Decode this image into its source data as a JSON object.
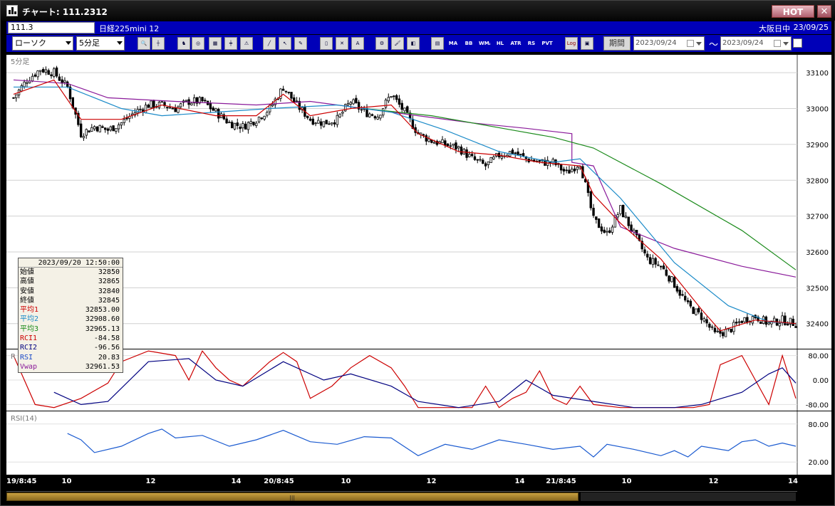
{
  "window": {
    "title": "チャート: 111.2312",
    "hot": "HOT",
    "close": "✕"
  },
  "info": {
    "symbol_code": "111.3",
    "symbol_name": "日経225mini 12",
    "session": "大阪日中",
    "date": "23/09/25"
  },
  "toolbar": {
    "chart_type": "ローソク",
    "interval": "5分足",
    "period_label": "期間",
    "start_date": "2023/09/24",
    "end_date": "2023/09/24",
    "tilde": "〜",
    "indicator_buttons": [
      "MA",
      "BB",
      "WMA",
      "HL",
      "ATR",
      "RS",
      "PVT",
      "Log"
    ]
  },
  "panes": {
    "price_title": "5分足",
    "rsi_title": "RSI(14)",
    "rci_title_fragment": "R"
  },
  "price_axis": {
    "ticks": [
      "33100",
      "33000",
      "32900",
      "32800",
      "32700",
      "32600",
      "32500",
      "32400"
    ]
  },
  "rci_axis": {
    "ticks": [
      "80.00",
      "0.00",
      "-80.00"
    ]
  },
  "rsi_axis": {
    "ticks": [
      "80.00",
      "20.00"
    ]
  },
  "x_axis": [
    "19/8:45",
    "10",
    "12",
    "14",
    "20/8:45",
    "10",
    "12",
    "14",
    "21/8:45",
    "10",
    "12",
    "14"
  ],
  "data_window": {
    "time": "2023/09/20 12:50:00",
    "rows": [
      {
        "label": "始値",
        "value": "32850",
        "color": "#000000"
      },
      {
        "label": "高値",
        "value": "32865",
        "color": "#000000"
      },
      {
        "label": "安値",
        "value": "32840",
        "color": "#000000"
      },
      {
        "label": "終値",
        "value": "32845",
        "color": "#000000"
      },
      {
        "label": "平均1",
        "value": "32853.00",
        "color": "#cc0000"
      },
      {
        "label": "平均2",
        "value": "32908.60",
        "color": "#1a8ac8"
      },
      {
        "label": "平均3",
        "value": "32965.13",
        "color": "#1a8a1a"
      },
      {
        "label": "RCI1",
        "value": "-84.58",
        "color": "#cc0000"
      },
      {
        "label": "RCI2",
        "value": "-96.56",
        "color": "#000080"
      },
      {
        "label": "RSI",
        "value": "20.83",
        "color": "#1a4ac8"
      },
      {
        "label": "Vwap",
        "value": "32961.53",
        "color": "#8a1a9a"
      }
    ]
  },
  "colors": {
    "ma1": "#cc0000",
    "ma2": "#1a8ac8",
    "ma3": "#1a8a1a",
    "vwap": "#8a1a9a",
    "rci1": "#cc0000",
    "rci2": "#000080",
    "rsi": "#1a5ad0"
  },
  "chart_data": {
    "type": "candlestick",
    "price_ylim": [
      32330,
      33150
    ],
    "session_breaks": [
      "19/8:45",
      "20/8:45",
      "21/8:45"
    ],
    "close_path": [
      [
        0,
        33030
      ],
      [
        5,
        33080
      ],
      [
        10,
        33110
      ],
      [
        15,
        33100
      ],
      [
        20,
        33060
      ],
      [
        25,
        32930
      ],
      [
        30,
        32950
      ],
      [
        35,
        32940
      ],
      [
        40,
        32960
      ],
      [
        45,
        32990
      ],
      [
        50,
        33010
      ],
      [
        55,
        33010
      ],
      [
        60,
        33000
      ],
      [
        65,
        33020
      ],
      [
        70,
        33020
      ],
      [
        75,
        32990
      ],
      [
        80,
        32960
      ],
      [
        85,
        32950
      ],
      [
        90,
        32970
      ],
      [
        95,
        33000
      ],
      [
        100,
        33060
      ],
      [
        105,
        33010
      ],
      [
        110,
        32970
      ],
      [
        115,
        32960
      ],
      [
        120,
        32970
      ],
      [
        125,
        33020
      ],
      [
        130,
        32990
      ],
      [
        135,
        32980
      ],
      [
        140,
        33040
      ],
      [
        145,
        32990
      ],
      [
        150,
        32930
      ],
      [
        155,
        32910
      ],
      [
        160,
        32900
      ],
      [
        165,
        32890
      ],
      [
        170,
        32860
      ],
      [
        175,
        32840
      ],
      [
        180,
        32870
      ],
      [
        185,
        32880
      ],
      [
        190,
        32860
      ],
      [
        195,
        32850
      ],
      [
        200,
        32850
      ],
      [
        205,
        32820
      ],
      [
        210,
        32850
      ],
      [
        215,
        32690
      ],
      [
        220,
        32650
      ],
      [
        225,
        32720
      ],
      [
        230,
        32650
      ],
      [
        235,
        32580
      ],
      [
        240,
        32560
      ],
      [
        245,
        32510
      ],
      [
        250,
        32450
      ],
      [
        255,
        32420
      ],
      [
        260,
        32370
      ],
      [
        265,
        32380
      ],
      [
        270,
        32410
      ],
      [
        275,
        32420
      ],
      [
        280,
        32400
      ],
      [
        285,
        32410
      ],
      [
        290,
        32400
      ]
    ],
    "ma1_path": [
      [
        0,
        33040
      ],
      [
        15,
        33080
      ],
      [
        25,
        32970
      ],
      [
        40,
        32970
      ],
      [
        55,
        33010
      ],
      [
        75,
        32980
      ],
      [
        90,
        32980
      ],
      [
        100,
        33040
      ],
      [
        110,
        32980
      ],
      [
        125,
        33000
      ],
      [
        140,
        33010
      ],
      [
        150,
        32930
      ],
      [
        165,
        32880
      ],
      [
        180,
        32870
      ],
      [
        195,
        32850
      ],
      [
        210,
        32840
      ],
      [
        215,
        32760
      ],
      [
        225,
        32680
      ],
      [
        240,
        32580
      ],
      [
        255,
        32440
      ],
      [
        262,
        32380
      ],
      [
        275,
        32410
      ],
      [
        290,
        32400
      ]
    ],
    "ma2_path": [
      [
        0,
        33060
      ],
      [
        20,
        33060
      ],
      [
        40,
        33000
      ],
      [
        55,
        32980
      ],
      [
        75,
        32990
      ],
      [
        95,
        33000
      ],
      [
        120,
        33010
      ],
      [
        140,
        32990
      ],
      [
        160,
        32940
      ],
      [
        180,
        32880
      ],
      [
        200,
        32850
      ],
      [
        210,
        32860
      ],
      [
        225,
        32750
      ],
      [
        245,
        32570
      ],
      [
        265,
        32450
      ],
      [
        280,
        32405
      ],
      [
        290,
        32400
      ]
    ],
    "ma3_path": [
      [
        130,
        33000
      ],
      [
        155,
        32980
      ],
      [
        185,
        32940
      ],
      [
        200,
        32920
      ],
      [
        215,
        32890
      ],
      [
        240,
        32790
      ],
      [
        270,
        32660
      ],
      [
        290,
        32550
      ]
    ],
    "vwap_path": [
      [
        0,
        33080
      ],
      [
        20,
        33070
      ],
      [
        35,
        33030
      ],
      [
        60,
        33020
      ],
      [
        90,
        33010
      ],
      [
        110,
        33020
      ],
      [
        140,
        32990
      ],
      [
        170,
        32960
      ],
      [
        190,
        32945
      ],
      [
        207,
        32930
      ],
      [
        207,
        32850
      ],
      [
        215,
        32840
      ],
      [
        225,
        32670
      ],
      [
        245,
        32610
      ],
      [
        270,
        32560
      ],
      [
        290,
        32530
      ]
    ],
    "rci_ylim": [
      -100,
      100
    ],
    "rci1_path": [
      [
        0,
        80
      ],
      [
        8,
        -80
      ],
      [
        15,
        -90
      ],
      [
        25,
        -60
      ],
      [
        35,
        -10
      ],
      [
        40,
        60
      ],
      [
        50,
        95
      ],
      [
        60,
        80
      ],
      [
        65,
        0
      ],
      [
        70,
        95
      ],
      [
        75,
        40
      ],
      [
        80,
        0
      ],
      [
        85,
        -20
      ],
      [
        95,
        60
      ],
      [
        100,
        90
      ],
      [
        105,
        60
      ],
      [
        110,
        -60
      ],
      [
        118,
        -20
      ],
      [
        125,
        40
      ],
      [
        132,
        80
      ],
      [
        140,
        40
      ],
      [
        145,
        -20
      ],
      [
        150,
        -90
      ],
      [
        160,
        -90
      ],
      [
        170,
        -90
      ],
      [
        175,
        -20
      ],
      [
        180,
        -90
      ],
      [
        185,
        -60
      ],
      [
        190,
        -40
      ],
      [
        195,
        30
      ],
      [
        200,
        -60
      ],
      [
        205,
        -80
      ],
      [
        210,
        -20
      ],
      [
        215,
        -80
      ],
      [
        225,
        -90
      ],
      [
        235,
        -90
      ],
      [
        245,
        -90
      ],
      [
        252,
        -90
      ],
      [
        258,
        -80
      ],
      [
        262,
        50
      ],
      [
        270,
        80
      ],
      [
        275,
        0
      ],
      [
        280,
        -80
      ],
      [
        285,
        80
      ],
      [
        290,
        -60
      ]
    ],
    "rci2_path": [
      [
        15,
        -40
      ],
      [
        25,
        -80
      ],
      [
        35,
        -70
      ],
      [
        50,
        60
      ],
      [
        65,
        70
      ],
      [
        75,
        0
      ],
      [
        85,
        -20
      ],
      [
        100,
        60
      ],
      [
        115,
        0
      ],
      [
        125,
        20
      ],
      [
        140,
        -20
      ],
      [
        150,
        -70
      ],
      [
        165,
        -90
      ],
      [
        180,
        -70
      ],
      [
        190,
        0
      ],
      [
        200,
        -50
      ],
      [
        215,
        -70
      ],
      [
        230,
        -90
      ],
      [
        245,
        -90
      ],
      [
        255,
        -80
      ],
      [
        270,
        -40
      ],
      [
        280,
        20
      ],
      [
        285,
        40
      ],
      [
        290,
        -10
      ]
    ],
    "rsi_ylim": [
      0,
      100
    ],
    "rsi_path": [
      [
        20,
        65
      ],
      [
        25,
        55
      ],
      [
        30,
        35
      ],
      [
        40,
        45
      ],
      [
        50,
        65
      ],
      [
        55,
        72
      ],
      [
        60,
        58
      ],
      [
        70,
        62
      ],
      [
        80,
        45
      ],
      [
        90,
        55
      ],
      [
        100,
        70
      ],
      [
        110,
        52
      ],
      [
        120,
        48
      ],
      [
        130,
        60
      ],
      [
        140,
        58
      ],
      [
        150,
        30
      ],
      [
        160,
        48
      ],
      [
        170,
        40
      ],
      [
        180,
        55
      ],
      [
        190,
        48
      ],
      [
        200,
        40
      ],
      [
        210,
        45
      ],
      [
        215,
        28
      ],
      [
        220,
        48
      ],
      [
        230,
        40
      ],
      [
        240,
        30
      ],
      [
        245,
        38
      ],
      [
        250,
        28
      ],
      [
        255,
        45
      ],
      [
        265,
        38
      ],
      [
        270,
        52
      ],
      [
        275,
        55
      ],
      [
        280,
        45
      ],
      [
        285,
        50
      ],
      [
        290,
        45
      ]
    ]
  }
}
